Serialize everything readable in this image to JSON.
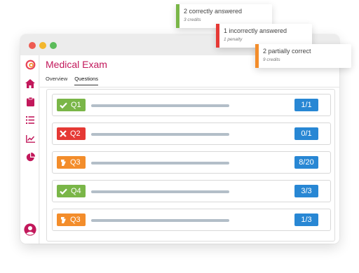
{
  "window": {
    "title": "Medical Exam",
    "tabs": [
      "Overview",
      "Questions"
    ],
    "active_tab": "Questions"
  },
  "sidebar": {
    "items": [
      {
        "icon": "logo-icon"
      },
      {
        "icon": "home-icon"
      },
      {
        "icon": "clipboard-icon"
      },
      {
        "icon": "list-icon"
      },
      {
        "icon": "line-chart-icon"
      },
      {
        "icon": "pie-chart-icon"
      },
      {
        "icon": "user-avatar-icon"
      }
    ]
  },
  "questions": [
    {
      "label": "Q1",
      "status": "correct",
      "score": "1/1"
    },
    {
      "label": "Q2",
      "status": "incorrect",
      "score": "0/1"
    },
    {
      "label": "Q3",
      "status": "partial",
      "score": "8/20"
    },
    {
      "label": "Q4",
      "status": "correct",
      "score": "3/3"
    },
    {
      "label": "Q3",
      "status": "partial",
      "score": "1/3"
    }
  ],
  "notifications": [
    {
      "title": "2 correctly answered",
      "sub": "3 credits",
      "color": "#7ab648"
    },
    {
      "title": "1 incorrectly answered",
      "sub": "1 penalty",
      "color": "#e53935"
    },
    {
      "title": "2 partially correct",
      "sub": "9 credits",
      "color": "#f38d2b"
    }
  ],
  "colors": {
    "accent": "#c2185b",
    "correct": "#7ab648",
    "incorrect": "#e53935",
    "partial": "#f38d2b",
    "score": "#2887d4"
  }
}
